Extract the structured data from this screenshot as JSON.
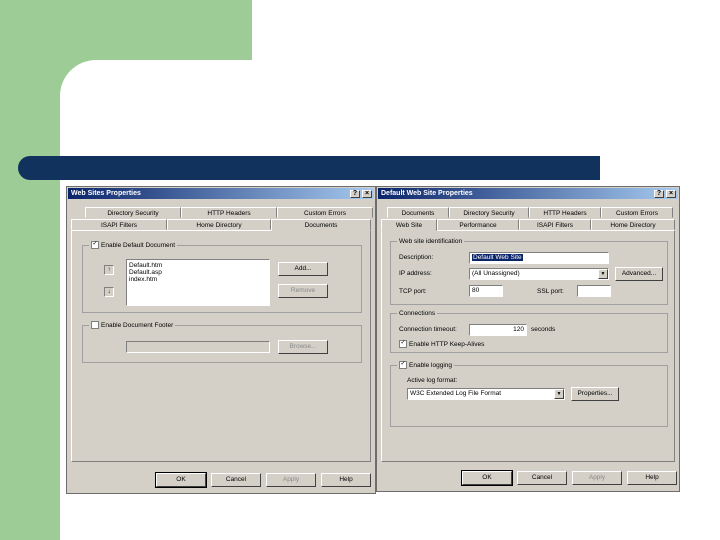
{
  "left_window": {
    "title": "Web Sites Properties",
    "tabs_row1": [
      "Directory Security",
      "HTTP Headers",
      "Custom Errors"
    ],
    "tabs_row2": [
      "ISAPI Filters",
      "Home Directory",
      "Documents"
    ],
    "enable_default_doc_label": "Enable Default Document",
    "documents": [
      "Default.htm",
      "Default.asp",
      "index.htm"
    ],
    "add_label": "Add...",
    "remove_label": "Remove",
    "enable_footer_label": "Enable Document Footer",
    "browse_label": "Browse...",
    "ok_label": "OK",
    "cancel_label": "Cancel",
    "apply_label": "Apply",
    "help_label": "Help"
  },
  "right_window": {
    "title": "Default Web Site Properties",
    "tabs_row1": [
      "Documents",
      "Directory Security",
      "HTTP Headers",
      "Custom Errors"
    ],
    "tabs_row2": [
      "Web Site",
      "Performance",
      "ISAPI Filters",
      "Home Directory"
    ],
    "identification_label": "Web site identification",
    "description_label": "Description:",
    "description_value": "Default Web Site",
    "ip_label": "IP address:",
    "ip_value": "(All Unassigned)",
    "advanced_label": "Advanced...",
    "tcp_label": "TCP port:",
    "tcp_value": "80",
    "ssl_label": "SSL port:",
    "ssl_value": "",
    "connections_label": "Connections",
    "timeout_label": "Connection timeout:",
    "timeout_value": "120",
    "seconds_label": "seconds",
    "keepalive_label": "Enable HTTP Keep-Alives",
    "logging_label": "Enable logging",
    "active_log_label": "Active log format:",
    "log_format_value": "W3C Extended Log File Format",
    "properties_label": "Properties...",
    "ok_label": "OK",
    "cancel_label": "Cancel",
    "apply_label": "Apply",
    "help_label": "Help"
  },
  "icons": {
    "help": "?",
    "close": "×",
    "check": "✓",
    "up": "↑",
    "down": "↓",
    "dropdown": "▼"
  }
}
